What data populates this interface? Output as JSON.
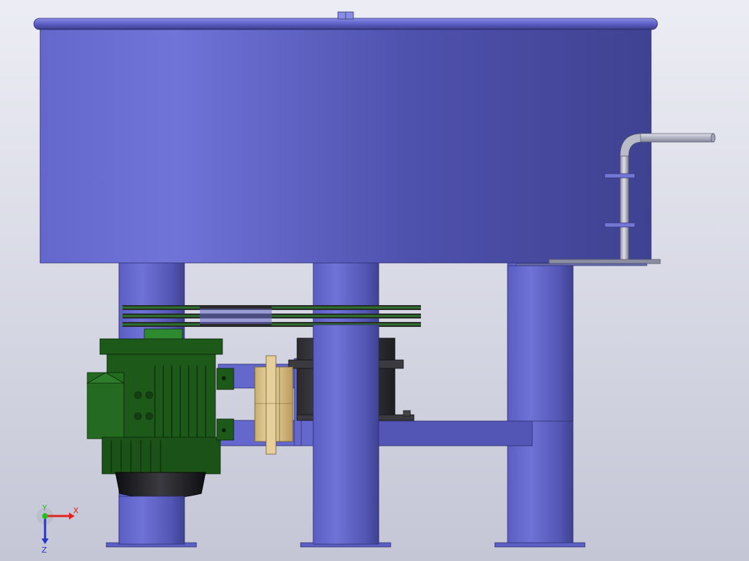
{
  "view": {
    "background_top": "#ecedf4",
    "background_bottom": "#c4c6d6"
  },
  "colors": {
    "tank": "#5c5fc4",
    "tank_light": "#7073d8",
    "tank_dark": "#3f4191",
    "motor": "#1d5a1a",
    "motor_dark": "#0f3410",
    "coupling": "#e0c78e",
    "pipe": "#b9bbc8",
    "gearbox": "#2f2f33",
    "belt": "#2a2a2a",
    "belt_green": "#2b6d2b"
  },
  "triad": {
    "x_label": "X",
    "y_label": "Y",
    "z_label": "Z",
    "x_color": "#e0231c",
    "y_color": "#1fbf1f",
    "z_color": "#2533cc"
  }
}
